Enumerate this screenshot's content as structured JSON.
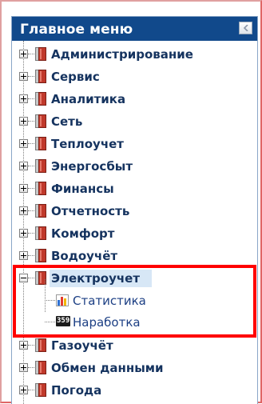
{
  "panel": {
    "title": "Главное меню",
    "collapse_icon": "chevron-left-icon"
  },
  "tree": {
    "items": [
      {
        "label": "Администрирование",
        "state": "collapsed"
      },
      {
        "label": "Сервис",
        "state": "collapsed"
      },
      {
        "label": "Аналитика",
        "state": "collapsed"
      },
      {
        "label": "Сеть",
        "state": "collapsed"
      },
      {
        "label": "Теплоучет",
        "state": "collapsed"
      },
      {
        "label": "Энергосбыт",
        "state": "collapsed"
      },
      {
        "label": "Финансы",
        "state": "collapsed"
      },
      {
        "label": "Отчетность",
        "state": "collapsed"
      },
      {
        "label": "Комфорт",
        "state": "collapsed"
      },
      {
        "label": "Водоучёт",
        "state": "collapsed"
      },
      {
        "label": "Электроучет",
        "state": "expanded",
        "selected": true,
        "children": [
          {
            "label": "Статистика",
            "icon": "bar-chart-icon"
          },
          {
            "label": "Наработка",
            "icon": "counter-icon",
            "icon_text": "359"
          }
        ]
      },
      {
        "label": "Газоучёт",
        "state": "collapsed"
      },
      {
        "label": "Обмен данными",
        "state": "collapsed"
      },
      {
        "label": "Погода",
        "state": "collapsed"
      }
    ]
  },
  "colors": {
    "header_bg": "#11498b",
    "label": "#15335f",
    "child_label": "#1c3f84",
    "highlight": "#ff0000",
    "selected_bg": "#d7e7f6"
  }
}
